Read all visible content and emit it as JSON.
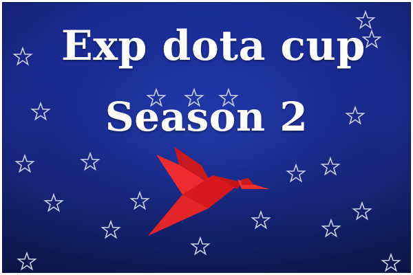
{
  "banner": {
    "title_line1": "Exp dota cup",
    "title_line2": "Season 2"
  },
  "colors": {
    "background": "#1a2a8a",
    "title_text": "#ffffff",
    "star_outline": "#c9cfe6",
    "bird_light": "#e8262a",
    "bird_dark": "#b51218",
    "border": "#ffffff"
  },
  "icons": {
    "star": "star-outline-icon",
    "bird": "origami-bird-logo"
  }
}
